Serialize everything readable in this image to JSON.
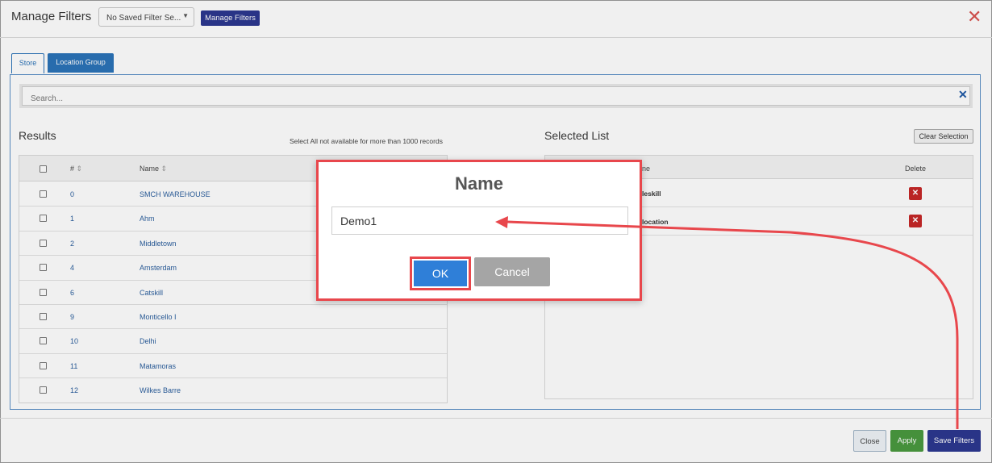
{
  "header": {
    "title": "Manage Filters",
    "saved_filter_select": "No Saved Filter Se...",
    "manage_filters_button": "Manage Filters"
  },
  "tabs": [
    {
      "label": "Store",
      "active": true
    },
    {
      "label": "Location Group",
      "active": false
    }
  ],
  "search": {
    "placeholder": "Search..."
  },
  "results": {
    "title": "Results",
    "note": "Select All not available for more than 1000 records",
    "columns": [
      "#",
      "Name"
    ],
    "rows": [
      {
        "num": "0",
        "name": "SMCH WAREHOUSE"
      },
      {
        "num": "1",
        "name": "Ahm"
      },
      {
        "num": "2",
        "name": "Middletown"
      },
      {
        "num": "4",
        "name": "Amsterdam"
      },
      {
        "num": "6",
        "name": "Catskill"
      },
      {
        "num": "9",
        "name": "Monticello I"
      },
      {
        "num": "10",
        "name": "Delhi"
      },
      {
        "num": "11",
        "name": "Matamoras"
      },
      {
        "num": "12",
        "name": "Wilkes Barre"
      }
    ]
  },
  "selected": {
    "title": "Selected List",
    "clear_button": "Clear Selection",
    "columns": [
      "ne",
      "Delete"
    ],
    "rows": [
      {
        "name": "leskill"
      },
      {
        "name": "location"
      }
    ]
  },
  "dialog": {
    "title": "Name",
    "input_value": "Demo1",
    "ok_label": "OK",
    "cancel_label": "Cancel"
  },
  "footer": {
    "close_label": "Close",
    "apply_label": "Apply",
    "save_label": "Save Filters"
  },
  "colors": {
    "primary_navy": "#2c3890",
    "tab_blue": "#2b73b8",
    "ok_blue": "#2f7fd8",
    "apply_green": "#4a9a3f",
    "delete_red": "#c62828",
    "highlight_red": "#e8474c"
  }
}
